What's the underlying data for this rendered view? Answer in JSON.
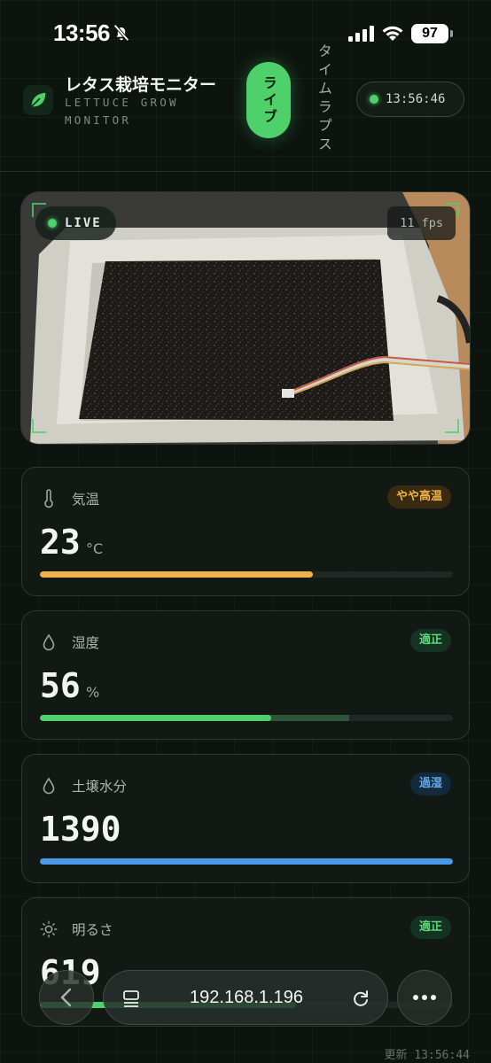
{
  "status_bar": {
    "time": "13:56",
    "battery": "97",
    "icons": [
      "bell-slash-icon",
      "signal-icon",
      "wifi-icon",
      "battery-icon"
    ]
  },
  "header": {
    "title": "レタス栽培モニター",
    "subtitle": "LETTUCE GROW MONITOR",
    "tab_live": "ライブ",
    "tab_timelapse": "タイムラプス",
    "clock": "13:56:46"
  },
  "camera": {
    "live_label": "LIVE",
    "fps": "11 fps"
  },
  "sensors": [
    {
      "label": "気温",
      "icon": "thermometer-icon",
      "value": "23",
      "unit": "°C",
      "status": "やや高温",
      "status_color": "#f0b347",
      "bar_fraction": 0.66,
      "bar_color": "#f0b347"
    },
    {
      "label": "湿度",
      "icon": "droplet-icon",
      "value": "56",
      "unit": "%",
      "status": "適正",
      "status_color": "#5fd878",
      "bar_fraction": 0.56,
      "bar_color": "#4ed06a",
      "ideal_range": [
        0.4,
        0.75
      ]
    },
    {
      "label": "土壌水分",
      "icon": "droplet-icon",
      "value": "1390",
      "unit": "",
      "status": "過湿",
      "status_color": "#62a9ec",
      "bar_fraction": 1.0,
      "bar_color": "#4a9ae8"
    },
    {
      "label": "明るさ",
      "icon": "sun-icon",
      "value": "619",
      "unit": "",
      "status": "適正",
      "status_color": "#5fd878",
      "bar_fraction": 0.62,
      "bar_color": "#4ed06a"
    }
  ],
  "browser": {
    "url": "192.168.1.196"
  },
  "footer": {
    "updated": "更新 13:56:44"
  },
  "colors": {
    "accent": "#4ed06a",
    "background": "#0d1410"
  }
}
